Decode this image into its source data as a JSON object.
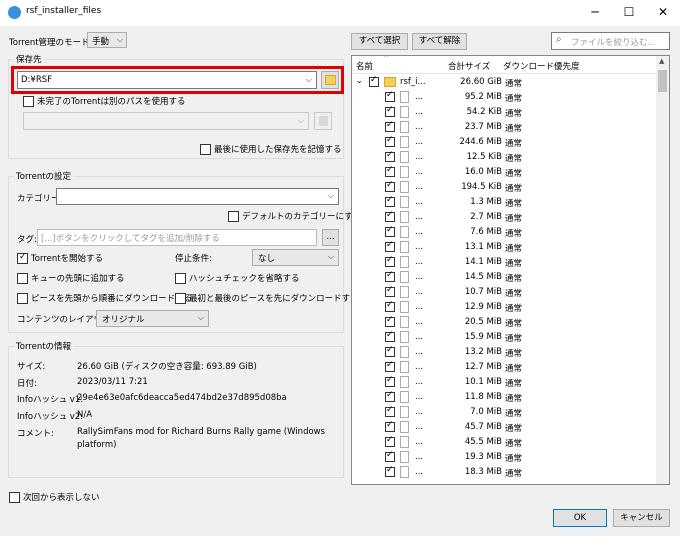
{
  "window": {
    "title": "rsf_installer_files",
    "minimize": "─",
    "maximize": "☐",
    "close": "✕"
  },
  "mode": {
    "label": "Torrent管理のモード:",
    "value": "手動"
  },
  "save_path": {
    "group_title": "保存先",
    "path_value": "D:¥RSF",
    "incomplete_label": "未完了のTorrentは別のパスを使用する",
    "remember_label": "最後に使用した保存先を記憶する"
  },
  "torrent_settings": {
    "group_title": "Torrentの設定",
    "category_label": "カテゴリー:",
    "default_category_label": "デフォルトのカテゴリーにする",
    "tags_label": "タグ:",
    "tags_placeholder": "[...]ボタンをクリックしてタグを追加/削除する",
    "tags_button": "...",
    "start_torrent_label": "Torrentを開始する",
    "stop_condition_label": "停止条件:",
    "stop_condition_value": "なし",
    "add_top_queue_label": "キューの先頭に追加する",
    "skip_hash_label": "ハッシュチェックを省略する",
    "sequential_label": "ピースを先頭から順番にダウンロードする",
    "first_last_label": "最初と最後のピースを先にダウンロードする",
    "layout_label": "コンテンツのレイアウト:",
    "layout_value": "オリジナル"
  },
  "torrent_info": {
    "group_title": "Torrentの情報",
    "size_label": "サイズ:",
    "size_value": "26.60 GiB (ディスクの空き容量: 693.89 GiB)",
    "date_label": "日付:",
    "date_value": "2023/03/11 7:21",
    "hash_v1_label": "Infoハッシュ v1:",
    "hash_v1_value": "29e4e63e0afc6deacca5ed474bd2e37d895d08ba",
    "hash_v2_label": "Infoハッシュ v2:",
    "hash_v2_value": "N/A",
    "comment_label": "コメント:",
    "comment_value_line1": "RallySimFans mod for Richard Burns Rally game (Windows",
    "comment_value_line2": "platform)"
  },
  "dont_show_label": "次回から表示しない",
  "files_toolbar": {
    "select_all": "すべて選択",
    "select_none": "すべて解除",
    "filter_placeholder": "ファイルを絞り込む..."
  },
  "files_header": {
    "name": "名前",
    "size": "合計サイズ",
    "priority": "ダウンロード優先度"
  },
  "files": {
    "root": {
      "name": "rsf_i...",
      "size": "26.60 GiB",
      "priority": "通常"
    },
    "items": [
      {
        "name": "...",
        "size": "95.2 MiB",
        "priority": "通常"
      },
      {
        "name": "...",
        "size": "54.2 KiB",
        "priority": "通常"
      },
      {
        "name": "...",
        "size": "23.7 MiB",
        "priority": "通常"
      },
      {
        "name": "...",
        "size": "244.6 MiB",
        "priority": "通常"
      },
      {
        "name": "...",
        "size": "12.5 KiB",
        "priority": "通常"
      },
      {
        "name": "...",
        "size": "16.0 MiB",
        "priority": "通常"
      },
      {
        "name": "...",
        "size": "194.5 KiB",
        "priority": "通常"
      },
      {
        "name": "...",
        "size": "1.3 MiB",
        "priority": "通常"
      },
      {
        "name": "...",
        "size": "2.7 MiB",
        "priority": "通常"
      },
      {
        "name": "...",
        "size": "7.6 MiB",
        "priority": "通常"
      },
      {
        "name": "...",
        "size": "13.1 MiB",
        "priority": "通常"
      },
      {
        "name": "...",
        "size": "14.1 MiB",
        "priority": "通常"
      },
      {
        "name": "...",
        "size": "14.5 MiB",
        "priority": "通常"
      },
      {
        "name": "...",
        "size": "10.7 MiB",
        "priority": "通常"
      },
      {
        "name": "...",
        "size": "12.9 MiB",
        "priority": "通常"
      },
      {
        "name": "...",
        "size": "20.5 MiB",
        "priority": "通常"
      },
      {
        "name": "...",
        "size": "15.9 MiB",
        "priority": "通常"
      },
      {
        "name": "...",
        "size": "13.2 MiB",
        "priority": "通常"
      },
      {
        "name": "...",
        "size": "12.7 MiB",
        "priority": "通常"
      },
      {
        "name": "...",
        "size": "10.1 MiB",
        "priority": "通常"
      },
      {
        "name": "...",
        "size": "11.8 MiB",
        "priority": "通常"
      },
      {
        "name": "...",
        "size": "7.0 MiB",
        "priority": "通常"
      },
      {
        "name": "...",
        "size": "45.7 MiB",
        "priority": "通常"
      },
      {
        "name": "...",
        "size": "45.5 MiB",
        "priority": "通常"
      },
      {
        "name": "...",
        "size": "19.3 MiB",
        "priority": "通常"
      },
      {
        "name": "...",
        "size": "18.3 MiB",
        "priority": "通常"
      }
    ]
  },
  "buttons": {
    "ok": "OK",
    "cancel": "キャンセル"
  },
  "colors": {
    "highlight_border": "#e00000",
    "folder_yellow": "#f5cf5a",
    "accent": "#0078d7"
  }
}
